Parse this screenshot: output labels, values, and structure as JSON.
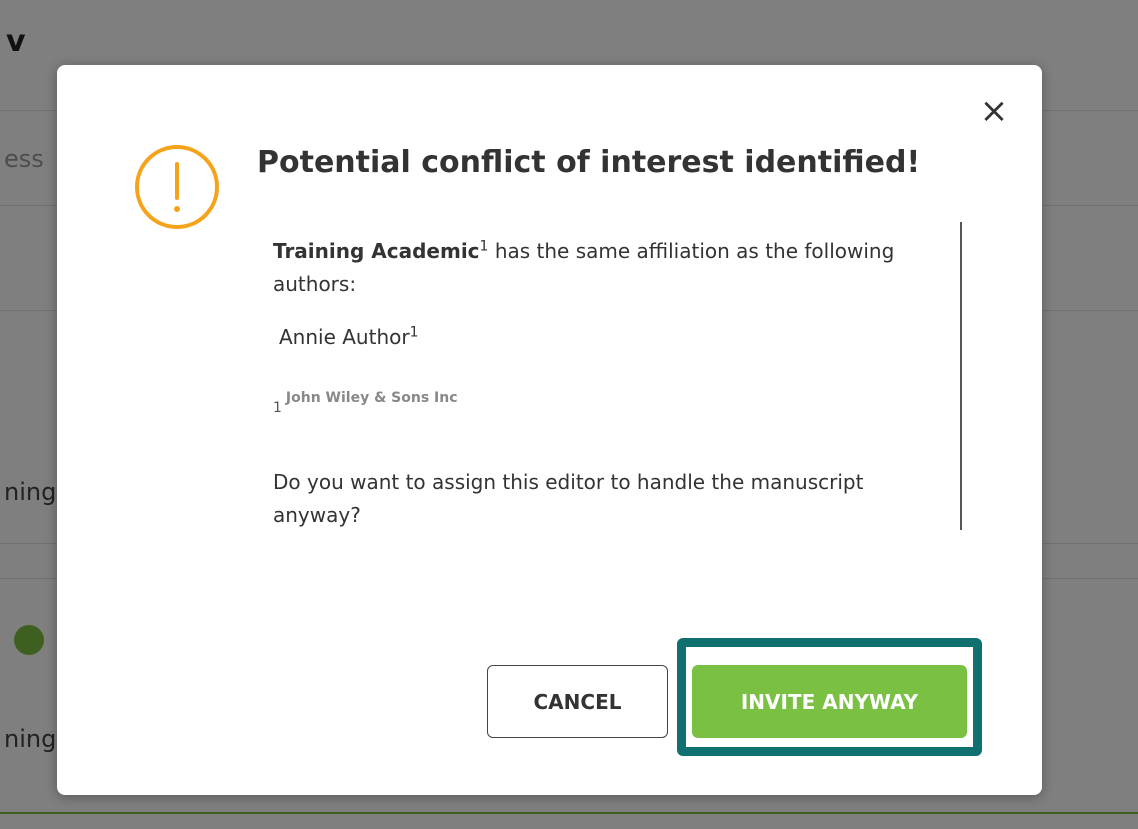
{
  "background": {
    "title_fragment": "v",
    "search_placeholder_fragment": "ess",
    "row_fragment_1": "ning",
    "row_fragment_2": "ning"
  },
  "modal": {
    "close_symbol": "×",
    "icon": "warning-circle-icon",
    "title": "Potential conflict of interest identified!",
    "editor_name": "Training Academic",
    "editor_sup": "1",
    "conflict_text": " has the same affiliation as the following authors:",
    "authors": [
      {
        "name": "Annie Author",
        "sup": "1"
      }
    ],
    "affiliations": [
      {
        "num": "1",
        "name": "John Wiley & Sons Inc"
      }
    ],
    "question": "Do you want to assign this editor to handle the manuscript anyway?",
    "cancel_label": "CANCEL",
    "invite_label": "INVITE ANYWAY"
  },
  "colors": {
    "accent_green": "#7ac143",
    "warning_orange": "#f5a31a",
    "highlight_teal": "#107070"
  }
}
